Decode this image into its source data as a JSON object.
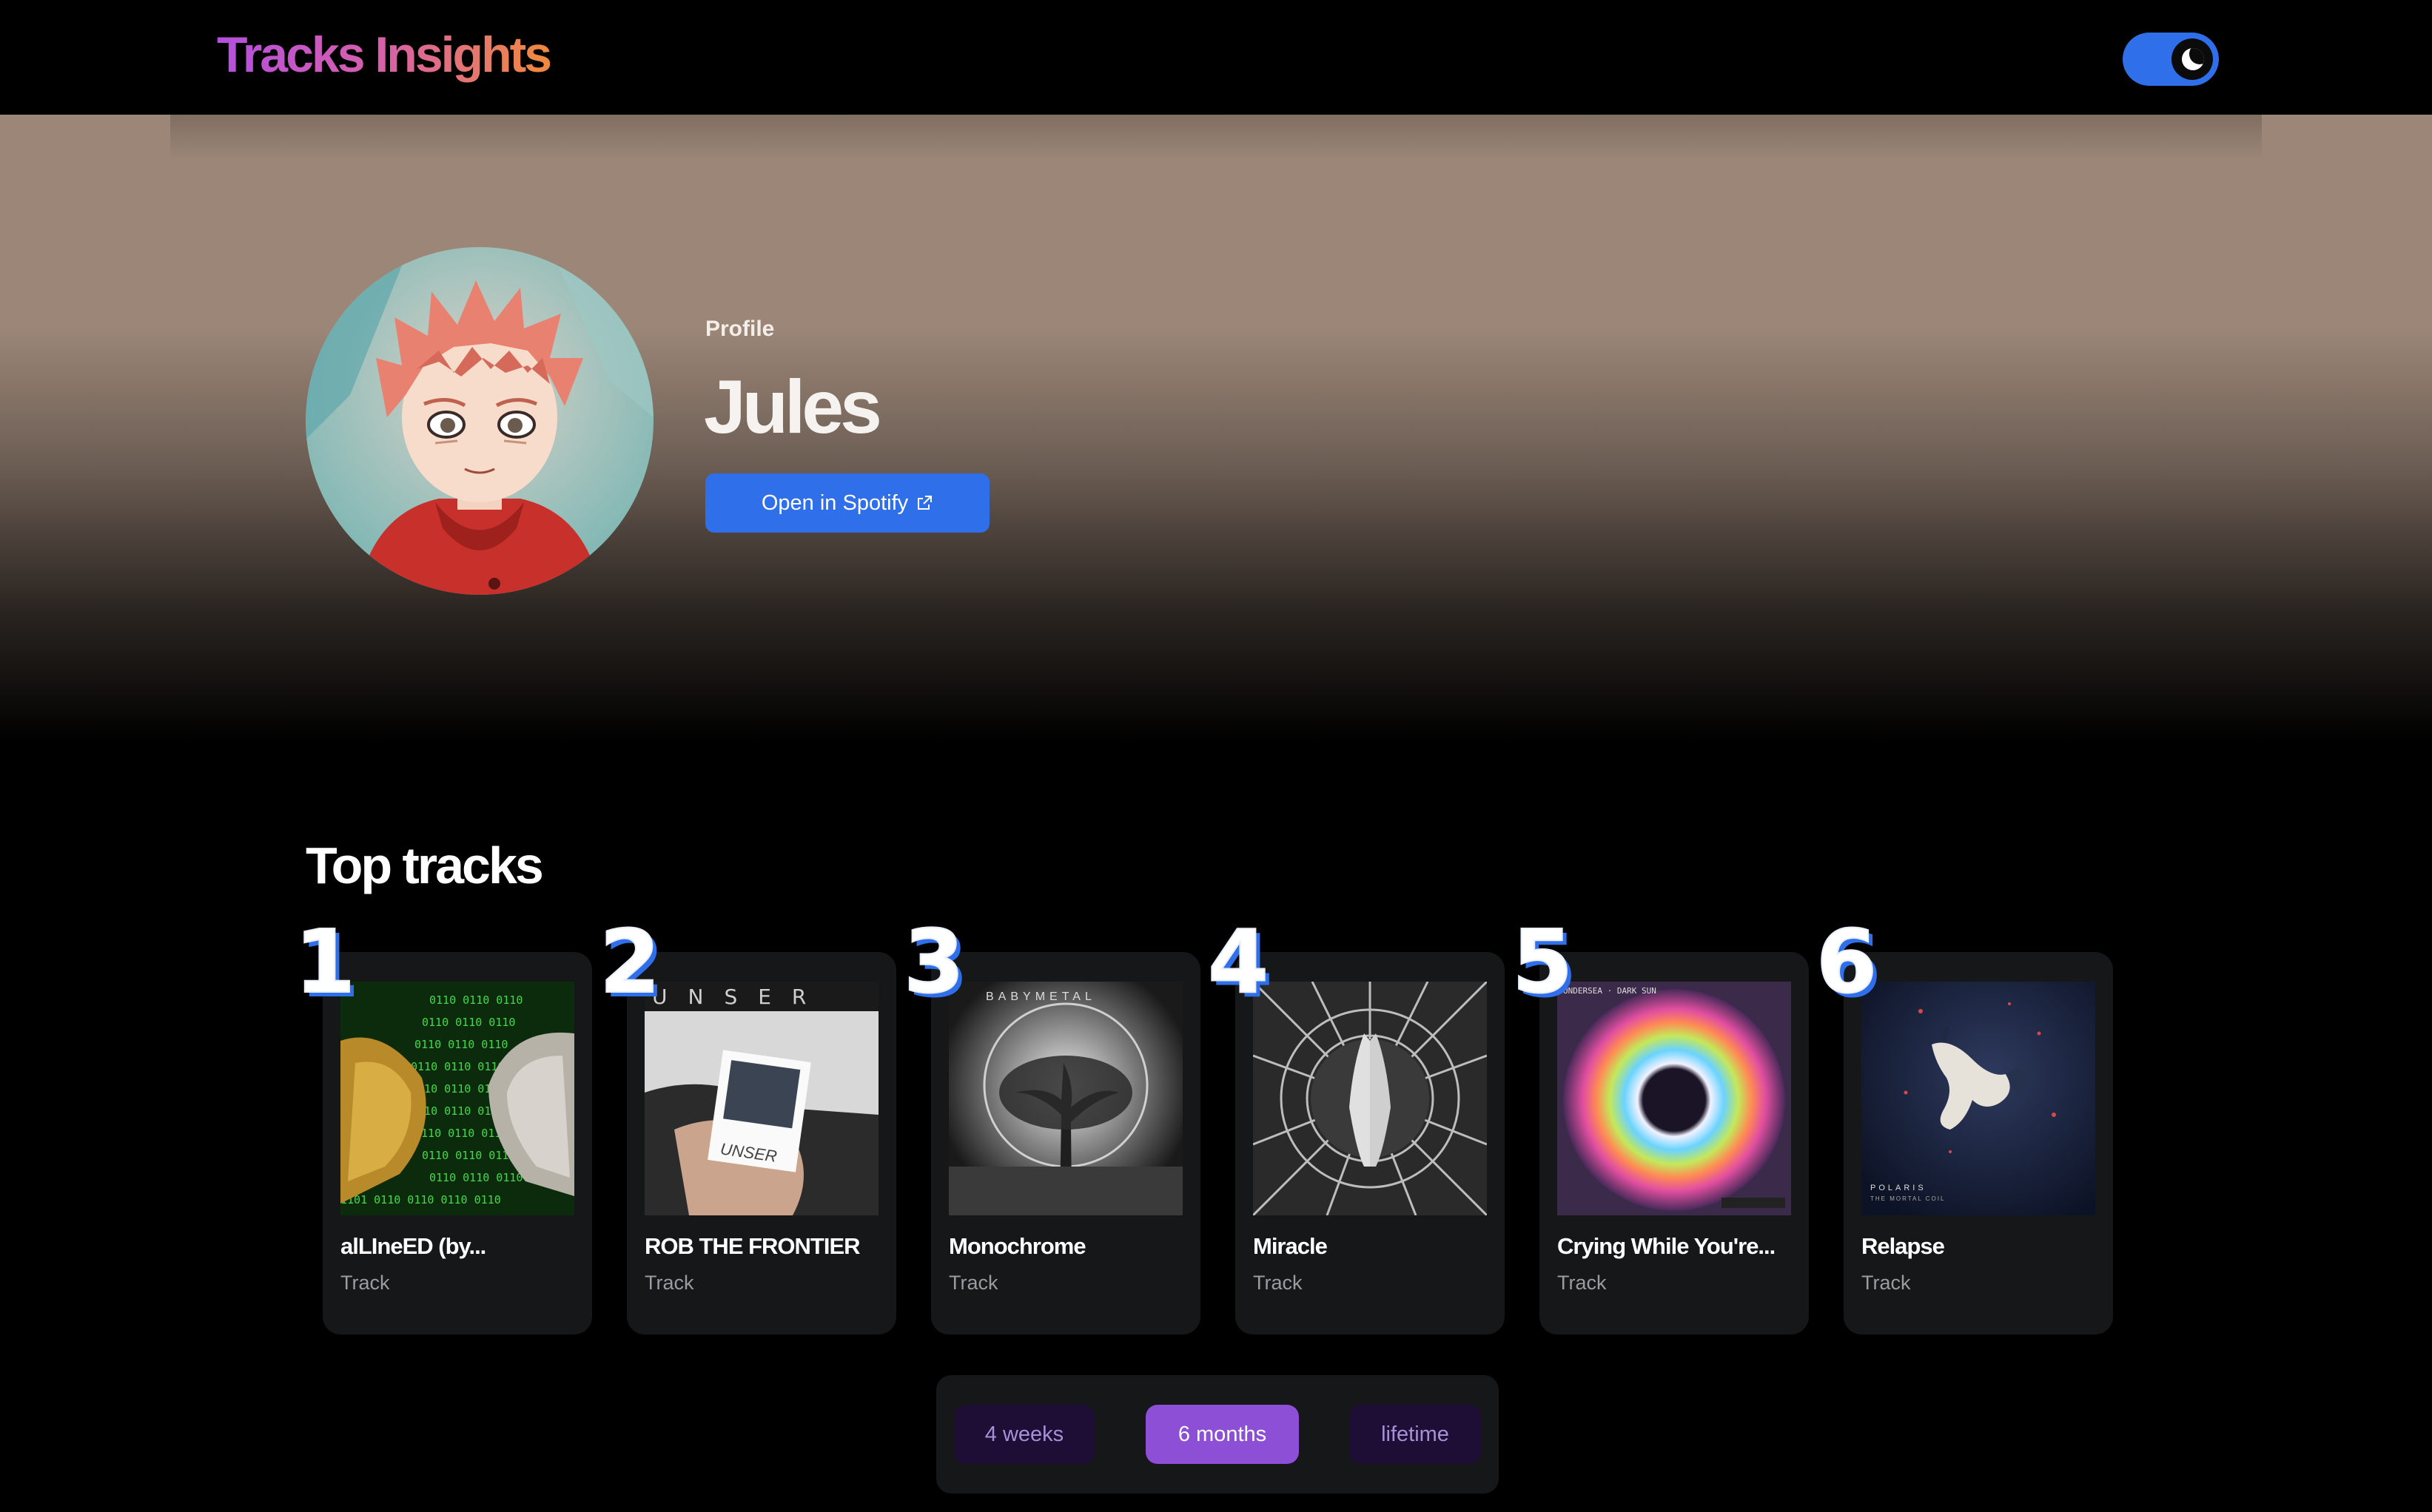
{
  "header": {
    "brand": "Tracks Insights",
    "theme_toggle": {
      "state": "dark",
      "icon": "moon-icon"
    }
  },
  "profile": {
    "label": "Profile",
    "name": "Jules",
    "open_button": "Open in Spotify",
    "open_icon": "external-link-icon"
  },
  "top_tracks": {
    "title": "Top tracks",
    "items": [
      {
        "rank": "1",
        "title": "alLIneED (by...",
        "type": "Track"
      },
      {
        "rank": "2",
        "title": "ROB THE FRONTIER",
        "type": "Track"
      },
      {
        "rank": "3",
        "title": "Monochrome",
        "type": "Track"
      },
      {
        "rank": "4",
        "title": "Miracle",
        "type": "Track"
      },
      {
        "rank": "5",
        "title": "Crying While You're...",
        "type": "Track"
      },
      {
        "rank": "6",
        "title": "Relapse",
        "type": "Track"
      }
    ]
  },
  "time_range": {
    "options": [
      "4 weeks",
      "6 months",
      "lifetime"
    ],
    "selected": "6 months"
  },
  "colors": {
    "accent": "#2f6fea",
    "range_active": "#8c4fd6",
    "card_bg": "#161719"
  }
}
